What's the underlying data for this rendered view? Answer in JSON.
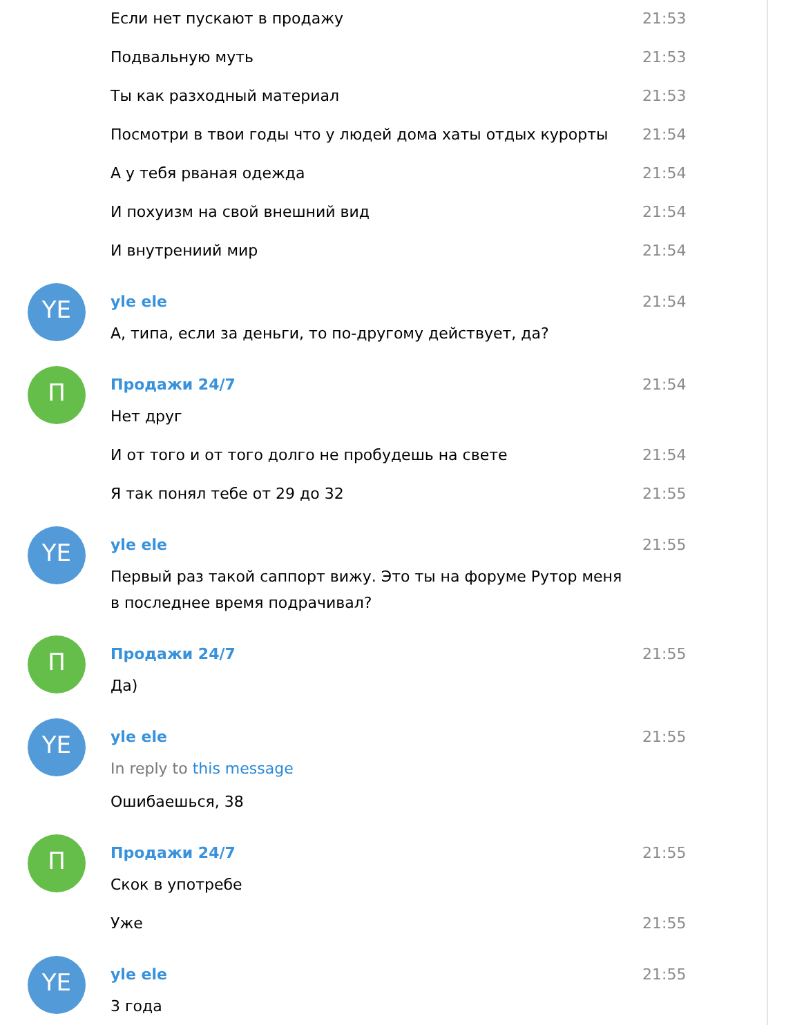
{
  "messages": [
    {
      "items": [
        {
          "text": "Если нет пускают в продажу",
          "time": "21:53"
        },
        {
          "text": "Подвальную муть",
          "time": "21:53"
        },
        {
          "text": "Ты как разходный материал",
          "time": "21:53"
        },
        {
          "text": "Посмотри в твои годы что у людей дома хаты отдых курорты",
          "time": "21:54"
        },
        {
          "text": "А у тебя рваная одежда",
          "time": "21:54"
        },
        {
          "text": "И похуизм на свой внешний вид",
          "time": "21:54"
        },
        {
          "text": "И внутрениий мир",
          "time": "21:54"
        }
      ]
    },
    {
      "sender": {
        "name": "yle ele",
        "initials": "YE",
        "color": "#529bd8"
      },
      "items": [
        {
          "text": "А, типа, если за деньги, то по-другому действует, да?",
          "time": "21:54"
        }
      ]
    },
    {
      "sender": {
        "name": "Продажи 24/7",
        "initials": "П",
        "color": "#65be4a"
      },
      "items": [
        {
          "text": "Нет друг",
          "time": "21:54"
        },
        {
          "text": "И от того и от того долго не пробудешь на свете",
          "time": "21:54"
        },
        {
          "text": "Я так понял тебе от 29 до 32",
          "time": "21:55"
        }
      ]
    },
    {
      "sender": {
        "name": "yle ele",
        "initials": "YE",
        "color": "#529bd8"
      },
      "items": [
        {
          "text": "Первый раз такой саппорт вижу. Это ты на форуме Рутор меня в последнее время подрачивал?",
          "time": "21:55"
        }
      ]
    },
    {
      "sender": {
        "name": "Продажи 24/7",
        "initials": "П",
        "color": "#65be4a"
      },
      "items": [
        {
          "text": "Да)",
          "time": "21:55"
        }
      ]
    },
    {
      "sender": {
        "name": "yle ele",
        "initials": "YE",
        "color": "#529bd8"
      },
      "items": [
        {
          "reply": {
            "prefix": "In reply to",
            "link": "this message"
          },
          "text": "Ошибаешься, 38",
          "time": "21:55"
        }
      ]
    },
    {
      "sender": {
        "name": "Продажи 24/7",
        "initials": "П",
        "color": "#65be4a"
      },
      "items": [
        {
          "text": "Скок в употребе",
          "time": "21:55"
        },
        {
          "text": "Уже",
          "time": "21:55"
        }
      ]
    },
    {
      "sender": {
        "name": "yle ele",
        "initials": "YE",
        "color": "#529bd8"
      },
      "items": [
        {
          "text": "3 года",
          "time": "21:55"
        }
      ]
    }
  ]
}
